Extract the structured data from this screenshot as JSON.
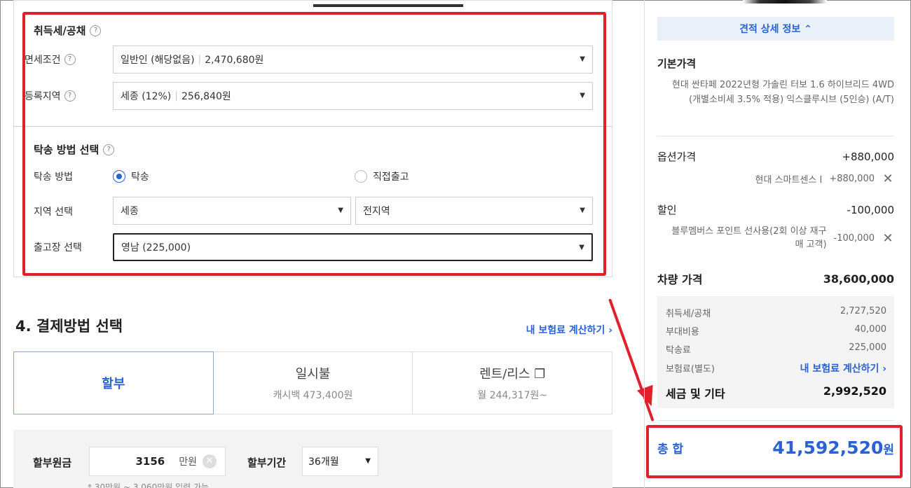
{
  "tax_section": {
    "title": "취득세/공채",
    "help": "?",
    "exemption": {
      "label": "면세조건",
      "value": "일반인 (해당없음)",
      "amount": "2,470,680원"
    },
    "region": {
      "label": "등록지역",
      "value": "세종 (12%)",
      "amount": "256,840원"
    }
  },
  "delivery_section": {
    "title": "탁송 방법 선택",
    "method_label": "탁송 방법",
    "options": [
      "탁송",
      "직접출고"
    ],
    "selected_option": "탁송",
    "region_label": "지역 선택",
    "region_value": "세종",
    "sub_region_value": "전지역",
    "depot_label": "출고장 선택",
    "depot_value": "영남 (225,000)"
  },
  "payment": {
    "title": "4. 결제방법 선택",
    "insurance_link": "내 보험료 계산하기 ›",
    "tabs": [
      {
        "label": "할부",
        "sub": ""
      },
      {
        "label": "일시불",
        "sub": "캐시백 473,400원"
      },
      {
        "label": "렌트/리스 ❐",
        "sub": "월 244,317원~"
      }
    ],
    "installment": {
      "principal_label": "할부원금",
      "principal_value": "3156",
      "principal_unit": "만원",
      "period_label": "할부기간",
      "period_value": "36개월",
      "note": "* 30만원 ~ 3,060만원 입력 가능"
    }
  },
  "summary": {
    "detail_button": "견적 상세 정보 ⌃",
    "base_price_title": "기본가격",
    "base_price_desc": "현대 싼타페 2022년형 가솔린 터보 1.6 하이브리드 4WD (개별소비세 3.5% 적용) 익스클루시브 (5인승) (A/T)",
    "option_label": "옵션가격",
    "option_total": "+880,000",
    "option_item": "현대 스마트센스 I",
    "option_item_price": "+880,000",
    "discount_label": "할인",
    "discount_total": "-100,000",
    "discount_item": "블루멤버스 포인트 선사용(2회 이상 재구매 고객)",
    "discount_item_price": "-100,000",
    "vehicle_price_label": "차량 가격",
    "vehicle_price": "38,600,000",
    "taxes": [
      {
        "label": "취득세/공채",
        "value": "2,727,520"
      },
      {
        "label": "부대비용",
        "value": "40,000"
      },
      {
        "label": "탁송료",
        "value": "225,000"
      },
      {
        "label": "보험료(별도)",
        "value": "내 보험료 계산하기 ›"
      }
    ],
    "tax_total_label": "세금 및 기타",
    "tax_total": "2,992,520",
    "grand_total_label": "총 합",
    "grand_total": "41,592,520",
    "grand_total_unit": "원",
    "remove_icon": "✕"
  },
  "colors": {
    "accent": "#2a62d6",
    "highlight": "#e0202a",
    "panel_bg": "#f3f3f3"
  }
}
